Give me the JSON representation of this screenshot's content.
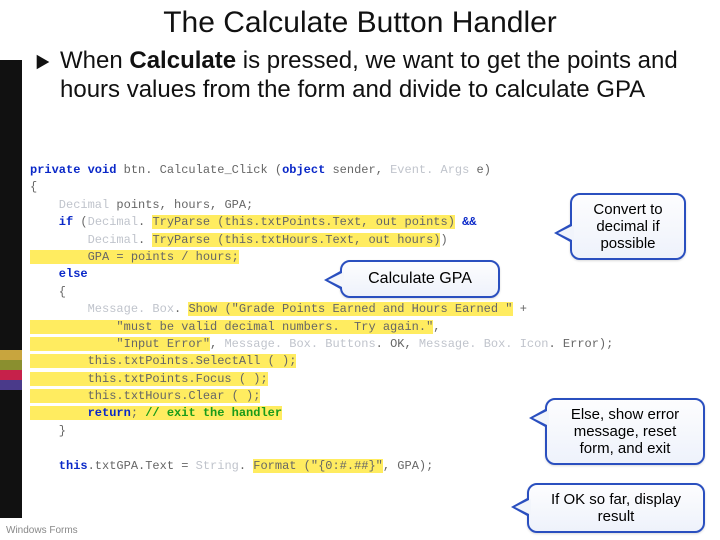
{
  "title": "The Calculate Button Handler",
  "bullet": {
    "prefix": "When ",
    "bold": "Calculate",
    "rest": " is pressed, we want to get the points and hours values from the form and divide to calculate GPA"
  },
  "code": {
    "l1a": "private void",
    "l1b": " btn. Calculate_Click (",
    "l1c": "object",
    "l1d": " sender, ",
    "l1e": "Event. Args",
    "l1f": " e)",
    "l2": "{",
    "l3a": "    Decimal",
    "l3b": " points, hours, GPA;",
    "l4a": "    if",
    "l4b": " (",
    "l4c": "Decimal",
    "l4d": ". ",
    "l4e": "TryParse (this.txtPoints.Text, out points)",
    "l4f": " &&",
    "l5a": "        Decimal",
    "l5b": ". ",
    "l5c": "TryParse (this.txtHours.Text, out hours)",
    "l5d": ")",
    "l6": "        GPA = points / hours;",
    "l7": "    else",
    "l8": "    {",
    "l9a": "        Message. Box",
    "l9b": ". ",
    "l9c": "Show (\"Grade Points Earned and Hours Earned \"",
    "l9d": " +",
    "l10": "            \"must be valid decimal numbers.  Try again.\"",
    "l10b": ",",
    "l11a": "            \"Input Error\"",
    "l11b": ", ",
    "l11c": "Message. Box. Buttons",
    "l11d": ". OK, ",
    "l11e": "Message. Box. Icon",
    "l11f": ". Error);",
    "l12": "        this.txtPoints.SelectAll ( );",
    "l13": "        this.txtPoints.Focus ( );",
    "l14": "        this.txtHours.Clear ( );",
    "l15a": "        return",
    "l15b": "; ",
    "l15c": "// exit the handler",
    "l16": "    }",
    "l17": " ",
    "l18a": "    this",
    "l18b": ".txtGPA.Text = ",
    "l18c": "String",
    "l18d": ". ",
    "l18e": "Format (\"{0:#.##}\"",
    "l18f": ", GPA);"
  },
  "callouts": {
    "c1": "Convert to decimal if possible",
    "c2": "Calculate GPA",
    "c3": "Else, show error message, reset form, and exit",
    "c4": "If OK so far, display result"
  },
  "footer": "Windows Forms",
  "stripes": [
    "#c8a53e",
    "#8a8f2f",
    "#c6214a",
    "#4a3a8a"
  ]
}
